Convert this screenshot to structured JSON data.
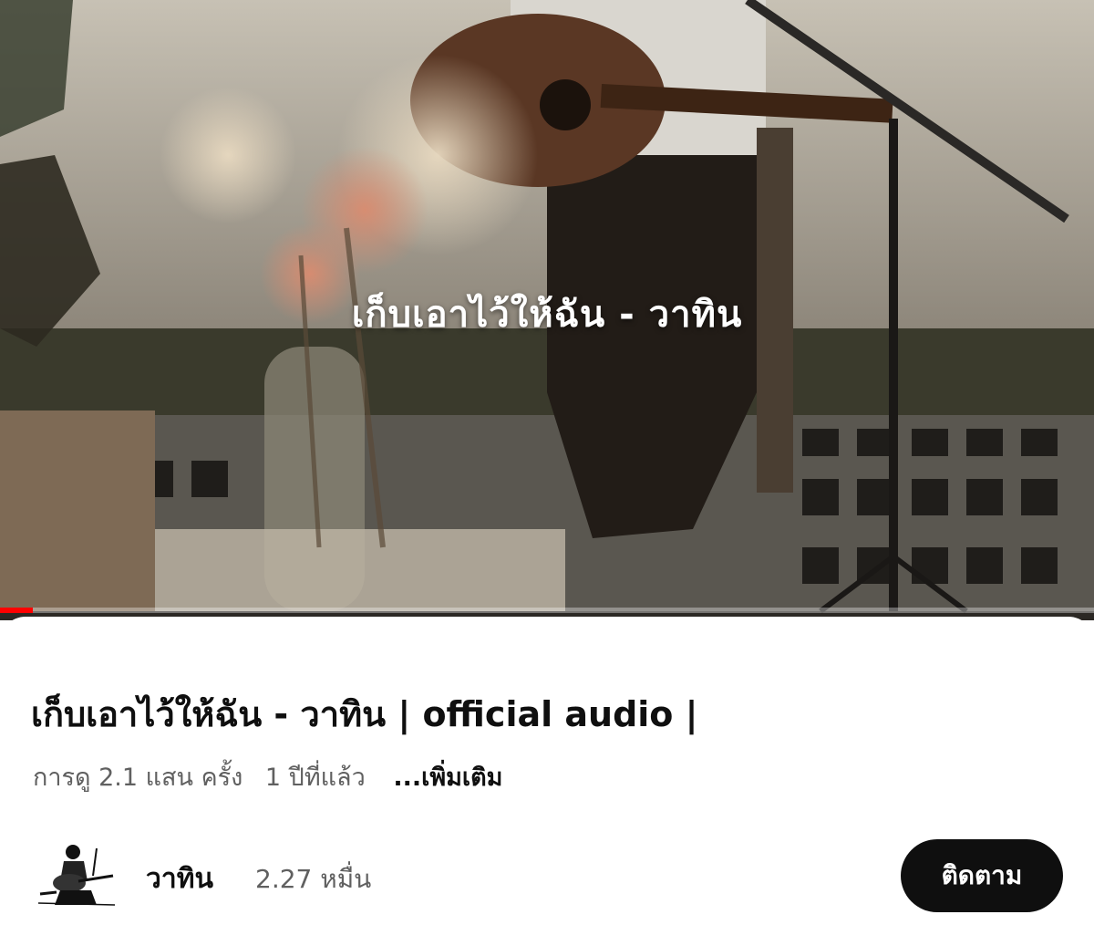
{
  "video": {
    "overlay_title": "เก็บเอาไว้ให้ฉัน - วาทิน",
    "progress": 0.03,
    "progress_color": "#ff0000"
  },
  "info": {
    "title": "เก็บเอาไว้ให้ฉัน - วาทิน  | official audio |",
    "views": "การดู 2.1 แสน ครั้ง",
    "age": "1 ปีที่แล้ว",
    "more": "...เพิ่มเติม"
  },
  "channel": {
    "name": "วาทิน",
    "subscribers": "2.27 หมื่น",
    "subscribe_label": "ติดตาม",
    "avatar_icon": "guitarist-sketch-icon"
  }
}
